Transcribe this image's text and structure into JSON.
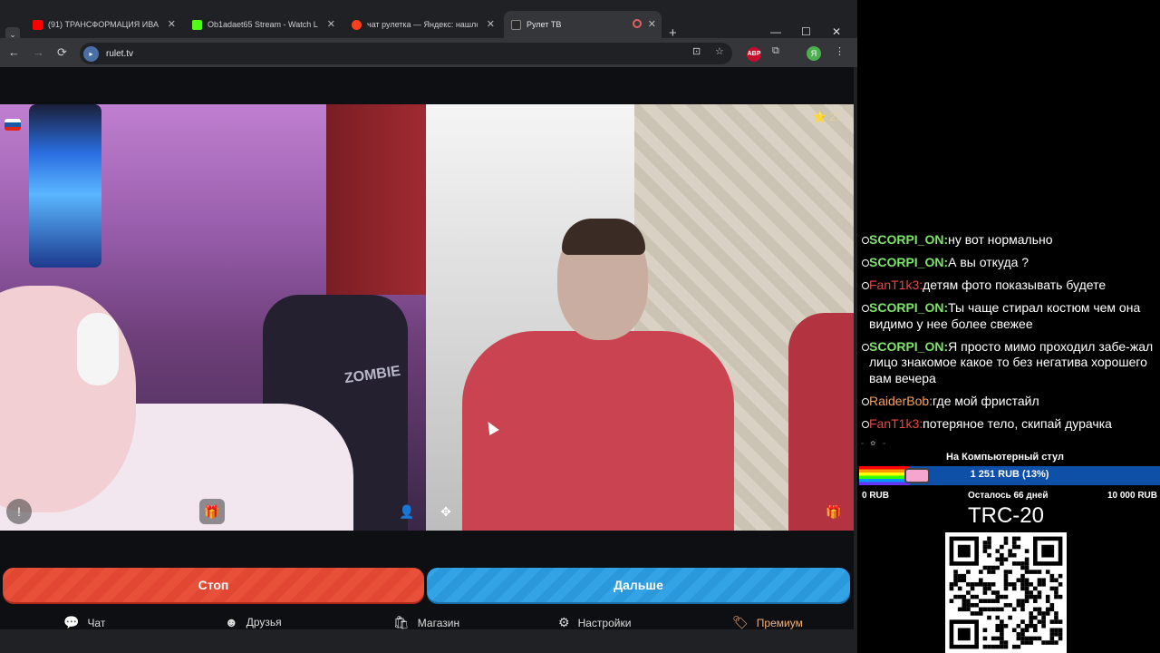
{
  "browser": {
    "tabs": [
      {
        "title": "(91) ТРАНСФОРМАЦИЯ ИВАН...",
        "fav_color": "#ff0000",
        "active": false
      },
      {
        "title": "Ob1adaet65 Stream - Watch L...",
        "fav_color": "#53fc18",
        "active": false
      },
      {
        "title": "чат рулетка — Яндекс: нашло...",
        "fav_color": "#fc3f1d",
        "active": false
      },
      {
        "title": "Рулет ТВ",
        "fav_color": "#2a2a2a",
        "active": true
      }
    ],
    "tab_close": "✕",
    "tab_menu": "⌄",
    "new_tab": "+",
    "window_controls": {
      "minimize": "—",
      "maximize": "☐",
      "close": "✕"
    },
    "url": "rulet.tv",
    "site_icon": "video-icon",
    "nav": {
      "back": "←",
      "forward": "→",
      "reload": "⟳"
    },
    "toolbar_icons": {
      "install": "⊡",
      "bookmark": "☆",
      "abp": "ABP",
      "extensions": "⧉",
      "profile": "Я",
      "menu": "⋮"
    }
  },
  "page": {
    "rating": "⭐ 27",
    "flag": [
      "#ffffff",
      "#1c57a5",
      "#e2231a"
    ],
    "overlay": {
      "report": "!",
      "gift": "🎁",
      "person": "👤",
      "game": "✥",
      "gift2": "🎁"
    },
    "buttons": {
      "stop": "Стоп",
      "next": "Дальше"
    },
    "chair_text": "ZOMBIE",
    "bottom_nav": [
      {
        "icon": "💬",
        "label": "Чат"
      },
      {
        "icon": "☻",
        "label": "Друзья"
      },
      {
        "icon": "🛍",
        "label": "Магазин"
      },
      {
        "icon": "⚙",
        "label": "Настройки"
      },
      {
        "icon": "🏷",
        "label": "Премиум"
      }
    ]
  },
  "chat": {
    "messages": [
      {
        "user": "SCORPI_ON:",
        "text": "ну вот нормально",
        "cls": "u1"
      },
      {
        "user": "SCORPI_ON:",
        "text": "А вы откуда ?",
        "cls": "u1"
      },
      {
        "user": "FanT1k3:",
        "text": "детям фото показывать будете",
        "cls": "u2"
      },
      {
        "user": "SCORPI_ON:",
        "text": "Ты чаще стирал костюм чем она видимо у нее более свежее",
        "cls": "u1"
      },
      {
        "user": "SCORPI_ON:",
        "text": "Я просто мимо проходил забе-жал лицо знакомое какое то без негатива хорошего вам вечера",
        "cls": "u1"
      },
      {
        "user": "RaiderBob:",
        "text": "где мой фристайл",
        "cls": "u3"
      },
      {
        "user": "FanT1k3:",
        "text": "потеряное тело, скипай дурачка",
        "cls": "u2"
      }
    ]
  },
  "donation": {
    "title": "На Компьютерный стул",
    "amount": "1 251 RUB (13%)",
    "progress": 0.13,
    "min": "0 RUB",
    "remaining": "Осталось 66 дней",
    "max": "10 000 RUB",
    "icons": "▫ ✿ ▫"
  },
  "crypto": {
    "label": "TRC-20"
  }
}
